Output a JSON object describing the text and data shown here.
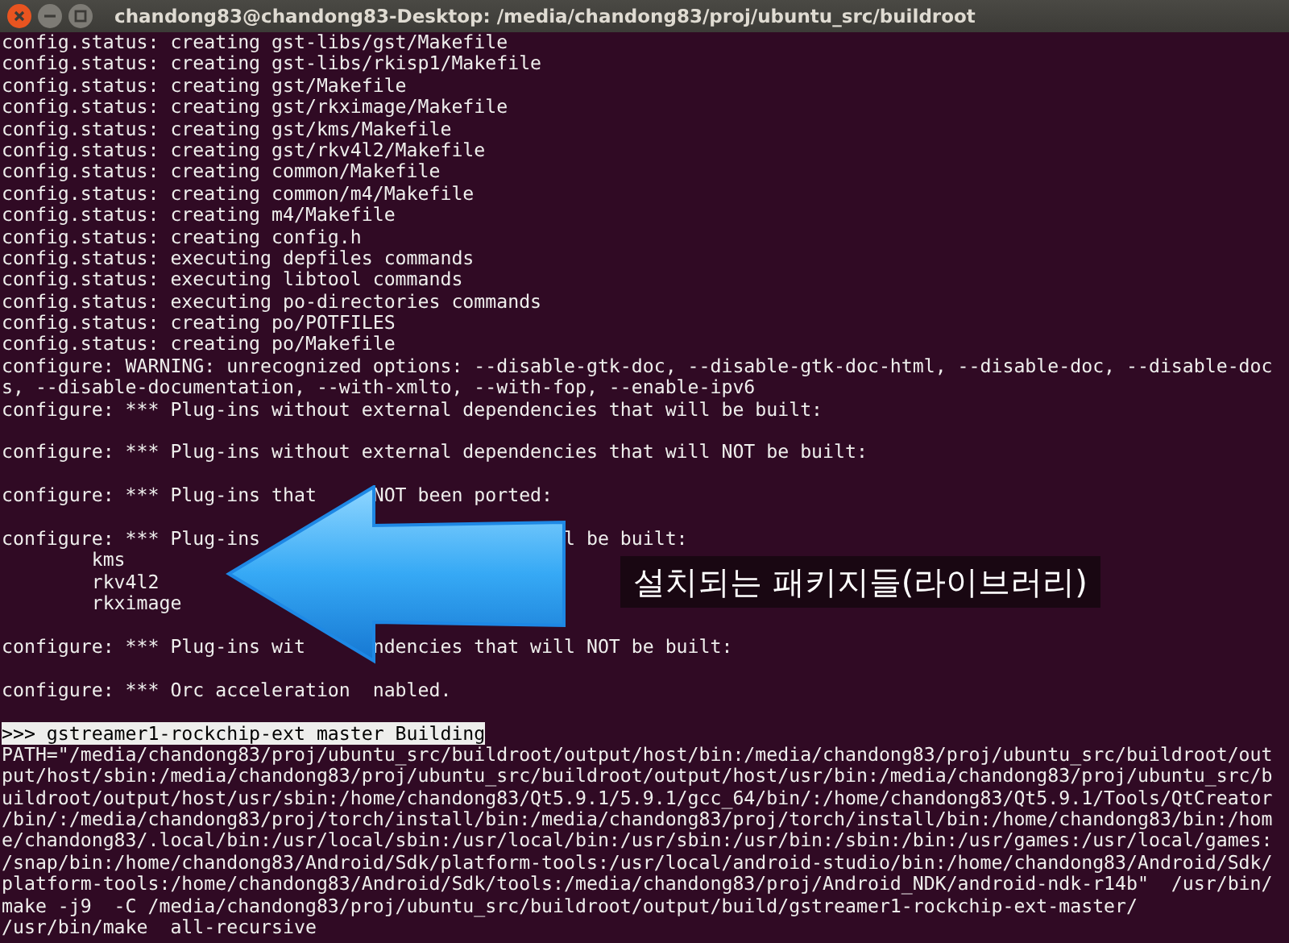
{
  "window": {
    "title": "chandong83@chandong83-Desktop: /media/chandong83/proj/ubuntu_src/buildroot"
  },
  "terminal": {
    "lines": [
      {
        "kind": "output",
        "text": "config.status: creating gst-libs/gst/Makefile"
      },
      {
        "kind": "output",
        "text": "config.status: creating gst-libs/rkisp1/Makefile"
      },
      {
        "kind": "output",
        "text": "config.status: creating gst/Makefile"
      },
      {
        "kind": "output",
        "text": "config.status: creating gst/rkximage/Makefile"
      },
      {
        "kind": "output",
        "text": "config.status: creating gst/kms/Makefile"
      },
      {
        "kind": "output",
        "text": "config.status: creating gst/rkv4l2/Makefile"
      },
      {
        "kind": "output",
        "text": "config.status: creating common/Makefile"
      },
      {
        "kind": "output",
        "text": "config.status: creating common/m4/Makefile"
      },
      {
        "kind": "output",
        "text": "config.status: creating m4/Makefile"
      },
      {
        "kind": "output",
        "text": "config.status: creating config.h"
      },
      {
        "kind": "output",
        "text": "config.status: executing depfiles commands"
      },
      {
        "kind": "output",
        "text": "config.status: executing libtool commands"
      },
      {
        "kind": "output",
        "text": "config.status: executing po-directories commands"
      },
      {
        "kind": "output",
        "text": "config.status: creating po/POTFILES"
      },
      {
        "kind": "output",
        "text": "config.status: creating po/Makefile"
      },
      {
        "kind": "output",
        "text": "configure: WARNING: unrecognized options: --disable-gtk-doc, --disable-gtk-doc-html, --disable-doc, --disable-doc"
      },
      {
        "kind": "output",
        "text": "s, --disable-documentation, --with-xmlto, --with-fop, --enable-ipv6"
      },
      {
        "kind": "output",
        "text": "configure: *** Plug-ins without external dependencies that will be built:"
      },
      {
        "kind": "blank"
      },
      {
        "kind": "output",
        "text": "configure: *** Plug-ins without external dependencies that will NOT be built:"
      },
      {
        "kind": "blank"
      },
      {
        "kind": "output",
        "text": "configure: *** Plug-ins that     NOT been ported:"
      },
      {
        "kind": "blank"
      },
      {
        "kind": "output",
        "text": "configure: *** Plug-ins                           l be built:"
      },
      {
        "kind": "output",
        "text": "        kms"
      },
      {
        "kind": "output",
        "text": "        rkv4l2"
      },
      {
        "kind": "output",
        "text": "        rkximage"
      },
      {
        "kind": "blank"
      },
      {
        "kind": "output",
        "text": "configure: *** Plug-ins wit      ndencies that will NOT be built:"
      },
      {
        "kind": "blank"
      },
      {
        "kind": "output",
        "text": "configure: *** Orc acceleration  nabled."
      },
      {
        "kind": "blank"
      },
      {
        "kind": "highlight",
        "text": ">>> gstreamer1-rockchip-ext master Building"
      },
      {
        "kind": "output",
        "text": "PATH=\"/media/chandong83/proj/ubuntu_src/buildroot/output/host/bin:/media/chandong83/proj/ubuntu_src/buildroot/out"
      },
      {
        "kind": "output",
        "text": "put/host/sbin:/media/chandong83/proj/ubuntu_src/buildroot/output/host/usr/bin:/media/chandong83/proj/ubuntu_src/b"
      },
      {
        "kind": "output",
        "text": "uildroot/output/host/usr/sbin:/home/chandong83/Qt5.9.1/5.9.1/gcc_64/bin/:/home/chandong83/Qt5.9.1/Tools/QtCreator"
      },
      {
        "kind": "output",
        "text": "/bin/:/media/chandong83/proj/torch/install/bin:/media/chandong83/proj/torch/install/bin:/home/chandong83/bin:/hom"
      },
      {
        "kind": "output",
        "text": "e/chandong83/.local/bin:/usr/local/sbin:/usr/local/bin:/usr/sbin:/usr/bin:/sbin:/bin:/usr/games:/usr/local/games:"
      },
      {
        "kind": "output",
        "text": "/snap/bin:/home/chandong83/Android/Sdk/platform-tools:/usr/local/android-studio/bin:/home/chandong83/Android/Sdk/"
      },
      {
        "kind": "output",
        "text": "platform-tools:/home/chandong83/Android/Sdk/tools:/media/chandong83/proj/Android_NDK/android-ndk-r14b\"  /usr/bin/"
      },
      {
        "kind": "output",
        "text": "make -j9  -C /media/chandong83/proj/ubuntu_src/buildroot/output/build/gstreamer1-rockchip-ext-master/"
      },
      {
        "kind": "output",
        "text": "/usr/bin/make  all-recursive"
      }
    ]
  },
  "annotation": {
    "label": "설치되는 패키지들(라이브러리)"
  }
}
